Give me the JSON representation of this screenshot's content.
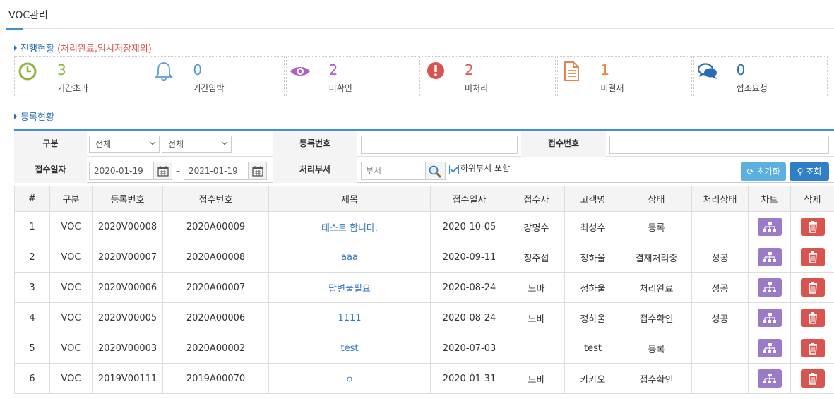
{
  "page": {
    "title": "VOC관리"
  },
  "progress": {
    "heading": "진행현황",
    "note": "(처리완료,임시저장제외)",
    "cards": [
      {
        "icon": "clock-icon",
        "count": "3",
        "label": "기간초과",
        "color": "#8db33a"
      },
      {
        "icon": "bell-icon",
        "count": "0",
        "label": "기간임박",
        "color": "#5b9bd5"
      },
      {
        "icon": "eye-icon",
        "count": "2",
        "label": "미확인",
        "color": "#b05fc2"
      },
      {
        "icon": "exclamation-icon",
        "count": "2",
        "label": "미처리",
        "color": "#d9534f"
      },
      {
        "icon": "document-icon",
        "count": "1",
        "label": "미결재",
        "color": "#e8834e"
      },
      {
        "icon": "chat-icon",
        "count": "0",
        "label": "협조요청",
        "color": "#2a6db3"
      }
    ]
  },
  "register": {
    "heading": "등록현황"
  },
  "search": {
    "category_label": "구분",
    "category_value_1": "전체",
    "category_value_2": "전체",
    "reg_no_label": "등록번호",
    "reg_no_value": "",
    "recv_no_label": "접수번호",
    "recv_no_value": "",
    "recv_date_label": "접수일자",
    "date_from": "2020-01-19",
    "date_sep": "–",
    "date_to": "2021-01-19",
    "dept_label": "처리부서",
    "dept_placeholder": "부서",
    "include_sub_label": "하위부서 포함",
    "reset_label": "초기화",
    "search_label": "조회"
  },
  "table": {
    "headers": [
      "#",
      "구분",
      "등록번호",
      "접수번호",
      "제목",
      "접수일자",
      "접수자",
      "고객명",
      "상태",
      "처리상태",
      "차트",
      "삭제"
    ],
    "rows": [
      {
        "no": "1",
        "type": "VOC",
        "reg_no": "2020V00008",
        "recv_no": "2020A00009",
        "title": "테스트 합니다.",
        "date": "2020-10-05",
        "receiver": "강명수",
        "customer": "최성수",
        "status": "등록",
        "proc_status": ""
      },
      {
        "no": "2",
        "type": "VOC",
        "reg_no": "2020V00007",
        "recv_no": "2020A00008",
        "title": "aaa",
        "date": "2020-09-11",
        "receiver": "정주섭",
        "customer": "정하울",
        "status": "결재처리중",
        "proc_status": "성공"
      },
      {
        "no": "3",
        "type": "VOC",
        "reg_no": "2020V00006",
        "recv_no": "2020A00007",
        "title": "답변불필요",
        "date": "2020-08-24",
        "receiver": "노바",
        "customer": "정하울",
        "status": "처리완료",
        "proc_status": "성공"
      },
      {
        "no": "4",
        "type": "VOC",
        "reg_no": "2020V00005",
        "recv_no": "2020A00006",
        "title": "1111",
        "date": "2020-08-24",
        "receiver": "노바",
        "customer": "정하울",
        "status": "접수확인",
        "proc_status": "성공"
      },
      {
        "no": "5",
        "type": "VOC",
        "reg_no": "2020V00003",
        "recv_no": "2020A00002",
        "title": "test",
        "date": "2020-07-03",
        "receiver": "",
        "customer": "test",
        "status": "등록",
        "proc_status": ""
      },
      {
        "no": "6",
        "type": "VOC",
        "reg_no": "2019V00111",
        "recv_no": "2019A00070",
        "title": "ㅇ",
        "date": "2020-01-31",
        "receiver": "노바",
        "customer": "카카오",
        "status": "접수확인",
        "proc_status": ""
      }
    ]
  }
}
